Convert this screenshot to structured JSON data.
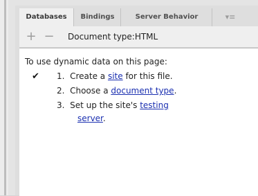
{
  "tabs": [
    {
      "label": "Databases",
      "active": true
    },
    {
      "label": "Bindings",
      "active": false
    },
    {
      "label": "Server Behavior",
      "active": false
    }
  ],
  "toolbar": {
    "add_icon": "plus-icon",
    "remove_icon": "minus-icon",
    "document_type": "Document type:HTML"
  },
  "content": {
    "intro": "To use dynamic data on this page:",
    "checkmark": "✔",
    "steps": [
      {
        "number": "1.",
        "before": "Create a ",
        "link": "site",
        "after": " for this file."
      },
      {
        "number": "2.",
        "before": "Choose a ",
        "link": "document type",
        "after": "."
      },
      {
        "number": "3.",
        "before": "Set up the site's ",
        "link": "testing",
        "link2": "server",
        "after": "."
      }
    ]
  },
  "colors": {
    "link": "#1a2fb0",
    "panel_background": "#dedede",
    "content_background": "#ffffff"
  }
}
